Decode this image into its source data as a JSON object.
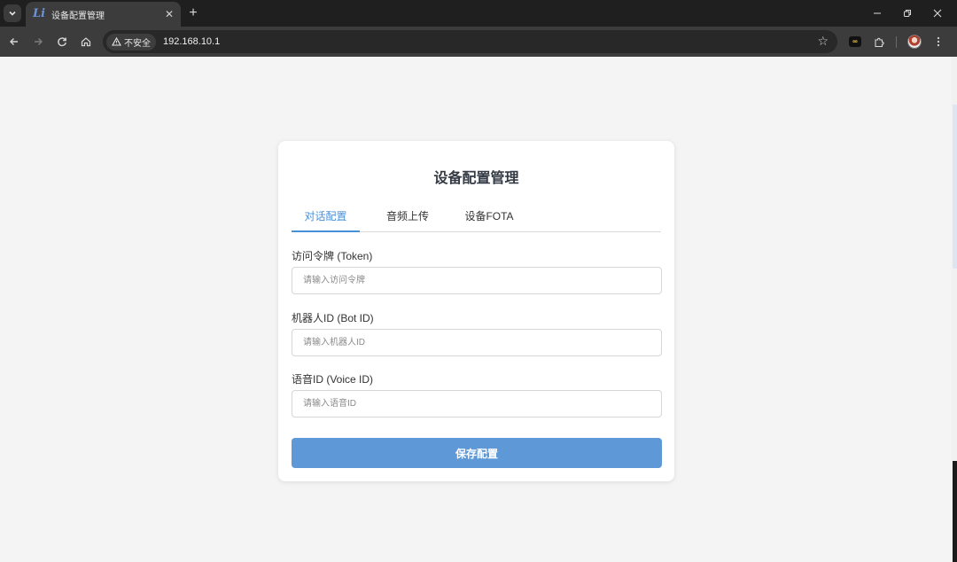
{
  "browser": {
    "tab": {
      "title": "设备配置管理",
      "favicon": "Li"
    },
    "security_label": "不安全",
    "url": "192.168.10.1"
  },
  "page": {
    "title": "设备配置管理",
    "tabs": [
      {
        "label": "对话配置",
        "active": true
      },
      {
        "label": "音频上传",
        "active": false
      },
      {
        "label": "设备FOTA",
        "active": false
      }
    ],
    "fields": [
      {
        "label": "访问令牌 (Token)",
        "placeholder": "请输入访问令牌",
        "value": ""
      },
      {
        "label": "机器人ID (Bot ID)",
        "placeholder": "请输入机器人ID",
        "value": ""
      },
      {
        "label": "语音ID (Voice ID)",
        "placeholder": "请输入语音ID",
        "value": ""
      }
    ],
    "save_label": "保存配置"
  },
  "colors": {
    "accent": "#4a90d9",
    "button": "#5e98d6",
    "background": "#f4f4f4"
  }
}
